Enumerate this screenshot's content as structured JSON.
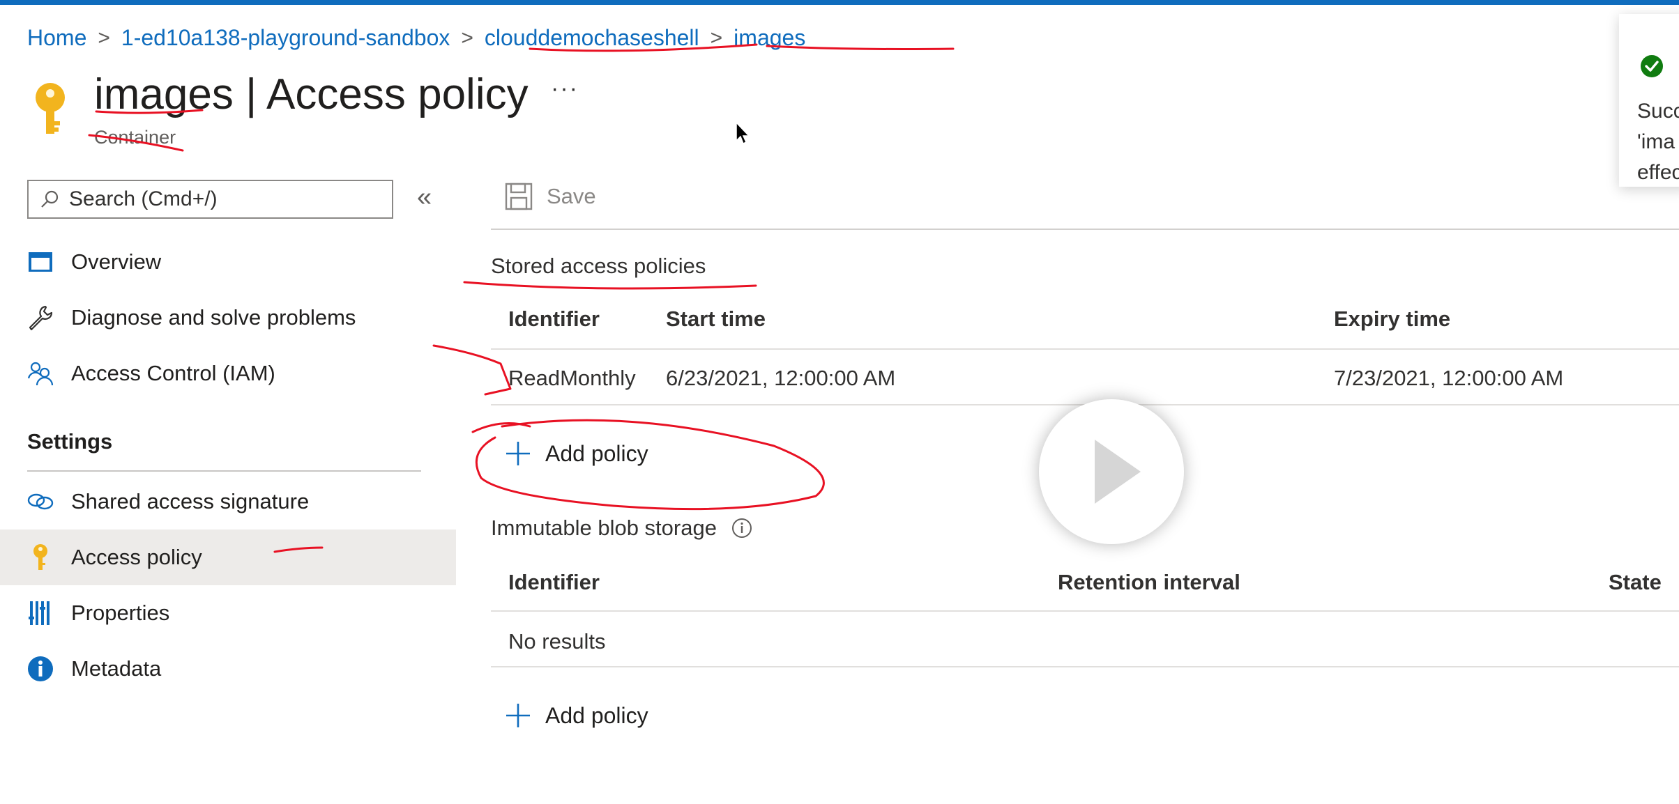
{
  "breadcrumb": {
    "items": [
      "Home",
      "1-ed10a138-playground-sandbox",
      "clouddemochaseshell",
      "images"
    ],
    "separator": ">"
  },
  "header": {
    "resource_name": "images",
    "page_name": "Access policy",
    "title_separator": "|",
    "resource_type": "Container",
    "more_label": "···"
  },
  "sidebar": {
    "search_placeholder": "Search (Cmd+/)",
    "collapse_label": "«",
    "items": [
      {
        "label": "Overview",
        "icon": "overview-icon"
      },
      {
        "label": "Diagnose and solve problems",
        "icon": "wrench-icon"
      },
      {
        "label": "Access Control (IAM)",
        "icon": "people-icon"
      }
    ],
    "settings_heading": "Settings",
    "settings_items": [
      {
        "label": "Shared access signature",
        "icon": "link-icon"
      },
      {
        "label": "Access policy",
        "icon": "key-icon",
        "active": true
      },
      {
        "label": "Properties",
        "icon": "properties-icon"
      },
      {
        "label": "Metadata",
        "icon": "info-icon"
      }
    ]
  },
  "toolbar": {
    "save_label": "Save",
    "save_enabled": false
  },
  "stored_policies": {
    "heading": "Stored access policies",
    "columns": [
      "Identifier",
      "Start time",
      "Expiry time"
    ],
    "rows": [
      {
        "identifier": "ReadMonthly",
        "start_time": "6/23/2021, 12:00:00 AM",
        "expiry_time": "7/23/2021, 12:00:00 AM"
      }
    ],
    "add_label": "Add policy"
  },
  "immutable_storage": {
    "heading": "Immutable blob storage",
    "columns": [
      "Identifier",
      "Retention interval",
      "State"
    ],
    "empty_text": "No results",
    "add_label": "Add policy"
  },
  "notification": {
    "status_icon": "success-check-icon",
    "lines": [
      "Succ",
      "'ima",
      "effec"
    ]
  },
  "colors": {
    "accent": "#0f6cbd",
    "success": "#107c10",
    "annotation": "#e81123",
    "key_gold": "#f2b41e",
    "active_bg": "#edebe9"
  }
}
